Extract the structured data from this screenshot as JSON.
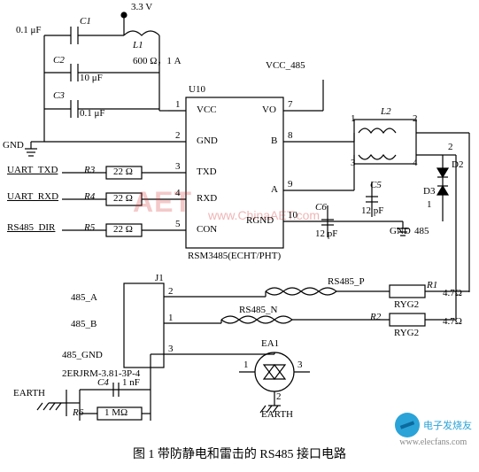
{
  "caption": "图 1  带防静电和雷击的 RS485 接口电路",
  "power": {
    "v33": "3.3 V",
    "vcc485": "VCC_485",
    "gnd": "GND",
    "gnd485": "485",
    "earth": "EARTH",
    "earth2": "EARTH"
  },
  "passives": {
    "C1": {
      "name": "C1",
      "value": "0.1 μF"
    },
    "C2": {
      "name": "C2",
      "value": "10 μF"
    },
    "C3": {
      "name": "C3",
      "value": "0.1 μF"
    },
    "C4": {
      "name": "C4",
      "value": "1 nF"
    },
    "C5": {
      "name": "C5",
      "value": "12 pF"
    },
    "C6": {
      "name": "C6",
      "value": "12 pF"
    },
    "L1": {
      "name": "L1",
      "value": "600 Ω，1 A"
    },
    "L2": {
      "name": "L2"
    },
    "R1": {
      "name": "R1",
      "value": "4.7Ω",
      "type": "RYG2"
    },
    "R2": {
      "name": "R2",
      "value": "4.7Ω",
      "type": "RYG2"
    },
    "R3": {
      "name": "R3",
      "value": "22 Ω"
    },
    "R4": {
      "name": "R4",
      "value": "22 Ω"
    },
    "R5": {
      "name": "R5",
      "value": "22 Ω"
    },
    "R6": {
      "name": "R6",
      "value": "1 MΩ"
    },
    "D2": {
      "name": "D2"
    },
    "D3": {
      "name": "D3"
    }
  },
  "ic": {
    "ref": "U10",
    "part": "RSM3485(ECHT/PHT)",
    "pins": {
      "1": "VCC",
      "2": "GND",
      "3": "TXD",
      "4": "RXD",
      "5": "CON",
      "7": "VO",
      "8": "B",
      "9": "A",
      "10": "RGND"
    }
  },
  "connector": {
    "ref": "J1",
    "part": "2ERJRM-3.81-3P-4",
    "pins": {
      "1": "485_B",
      "2": "485_A",
      "3": "485_GND"
    },
    "pinnums": {
      "p1": "1",
      "p2": "2",
      "p3": "3"
    }
  },
  "protection": {
    "ea1": "EA1",
    "nets": {
      "p": "RS485_P",
      "n": "RS485_N"
    }
  },
  "uart": {
    "txd": "UART_TXD",
    "rxd": "UART_RXD",
    "dir": "RS485_DIR"
  },
  "pinnum": {
    "p1": "1",
    "p2": "2",
    "p3": "3",
    "p4": "4",
    "p5": "5",
    "p7": "7",
    "p8": "8",
    "p9": "9",
    "p10": "10"
  },
  "l2pins": {
    "a": "1",
    "b": "2",
    "c": "3",
    "d": "4"
  },
  "d2pins": {
    "a": "1",
    "b": "2"
  },
  "eapins": {
    "a": "1",
    "b": "2",
    "c": "3"
  },
  "watermark": {
    "big": "AET",
    "url": "www.ChinaAET.com"
  },
  "brand": {
    "name": "电子发烧友",
    "url": "www.elecfans.com"
  }
}
